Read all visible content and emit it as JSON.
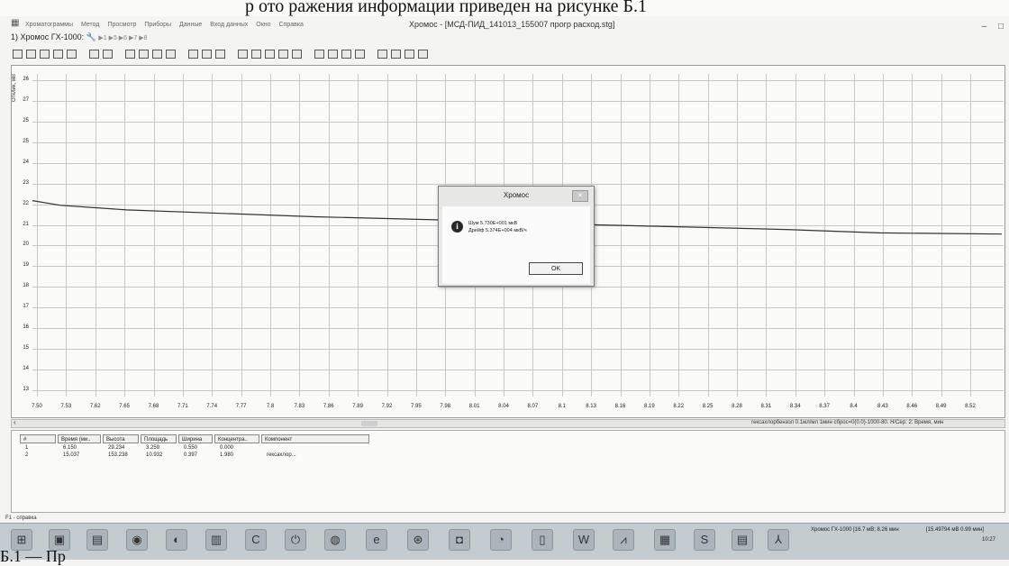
{
  "document": {
    "heading_fragment": "р ото ражения информации приведен на рисунке Б.1",
    "caption_fragment": "Б.1 — Пр"
  },
  "window": {
    "title": "Хромос - [МСД-ПИД_141013_155007 прогр расход.stg]",
    "menu": [
      "Хроматограммы",
      "Метод",
      "Просмотр",
      "Приборы",
      "Данные",
      "Вход данных",
      "Окно",
      "Справка"
    ],
    "controls": [
      "–",
      "□"
    ]
  },
  "docbar": {
    "label": "1) Хромос ГХ-1000:",
    "channels": "▶1 ▶5 ▶6 ▶7 ▶8"
  },
  "chart_data": {
    "type": "line",
    "title": "",
    "xlabel": "",
    "ylabel": "Отклик, мВ",
    "y_ticks": [
      "26",
      "27",
      "25",
      "25",
      "24",
      "23",
      "22",
      "21",
      "20",
      "19",
      "18",
      "17",
      "16",
      "15",
      "14",
      "13"
    ],
    "x_ticks": [
      "7.50",
      "7.53",
      "7.62",
      "7.65",
      "7.68",
      "7.71",
      "7.74",
      "7.77",
      "7.8",
      "7.83",
      "7.86",
      "7.89",
      "7.92",
      "7.95",
      "7.98",
      "8.01",
      "8.04",
      "8.07",
      "8.1",
      "8.13",
      "8.16",
      "8.19",
      "8.22",
      "8.25",
      "8.28",
      "8.31",
      "8.34",
      "8.37",
      "8.4",
      "8.43",
      "8.46",
      "8.49",
      "8.52"
    ],
    "xlim": [
      7.5,
      8.53
    ],
    "ylim": [
      12.5,
      26.5
    ],
    "grid": true,
    "series": [
      {
        "x": [
          7.5,
          7.53,
          7.6,
          7.7,
          7.8,
          7.9,
          8.0,
          8.1,
          8.2,
          8.3,
          8.4,
          8.53
        ],
        "y": [
          21.0,
          20.8,
          20.6,
          20.45,
          20.3,
          20.2,
          20.1,
          19.95,
          19.85,
          19.75,
          19.6,
          19.55
        ]
      }
    ]
  },
  "method_info": "гексахлорбензол 0.1мл/мл 1мин сброс=0(0.0)-1000-80.   Н/Сер: 2:  Время, мин",
  "table": {
    "columns": [
      "#",
      "Время (ми..",
      "Высота",
      "Площадь",
      "Ширина",
      "Концентра..",
      "Компонент"
    ],
    "rows": [
      [
        "1",
        "6.150",
        "29.234",
        "3.259",
        "0.550",
        "0.000",
        ""
      ],
      [
        "2",
        "15.037",
        "153.238",
        "10.932",
        "0.397",
        "1.980",
        "гексахлор..."
      ]
    ]
  },
  "status_text": "F1 - справка",
  "dialog": {
    "title": "Хромос",
    "line1": "Шум 5.730E+001 мкВ",
    "line2": "Дрейф 5.374E+004 мкВ/ч",
    "ok_label": "OK",
    "close_label": "✕"
  },
  "taskbar": {
    "tray_left": "Хромос ГХ-1000 [16.7 мВ; 8.26 мин",
    "tray_right": "[15.49794 мВ 0.99 мин]",
    "time": "10:27"
  }
}
